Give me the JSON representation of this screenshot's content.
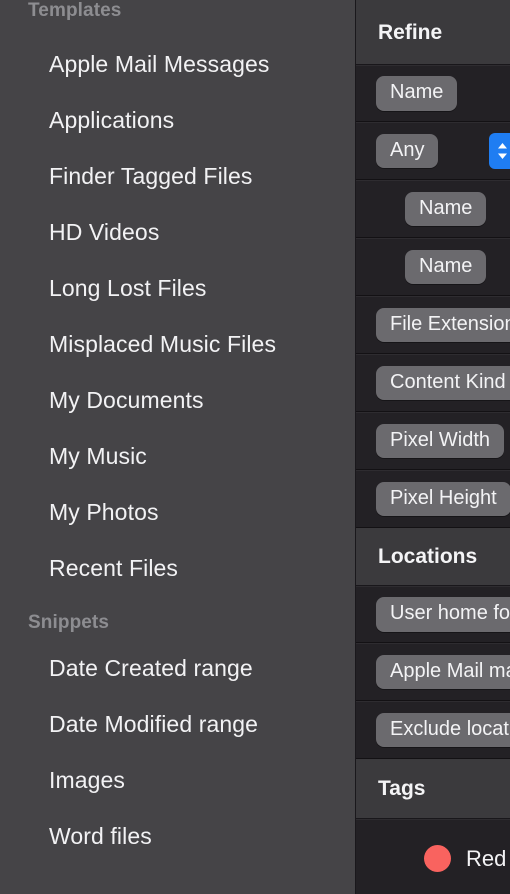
{
  "sidebar": {
    "groups": [
      {
        "title": "Templates",
        "items": [
          {
            "label": "Apple Mail Messages"
          },
          {
            "label": "Applications"
          },
          {
            "label": "Finder Tagged Files"
          },
          {
            "label": "HD Videos"
          },
          {
            "label": "Long Lost Files"
          },
          {
            "label": "Misplaced Music Files"
          },
          {
            "label": "My Documents"
          },
          {
            "label": "My Music"
          },
          {
            "label": "My Photos"
          },
          {
            "label": "Recent Files"
          }
        ]
      },
      {
        "title": "Snippets",
        "items": [
          {
            "label": "Date Created range"
          },
          {
            "label": "Date Modified range"
          },
          {
            "label": "Images"
          },
          {
            "label": "Word files"
          }
        ]
      }
    ]
  },
  "panel": {
    "sections": [
      {
        "header": "Refine",
        "rows": [
          {
            "label": "Name",
            "indent": 0,
            "stepper": false
          },
          {
            "label": "Any",
            "indent": 0,
            "stepper": true
          },
          {
            "label": "Name",
            "indent": 1,
            "stepper": false
          },
          {
            "label": "Name",
            "indent": 1,
            "stepper": false
          },
          {
            "label": "File Extension",
            "indent": 0,
            "stepper": false
          },
          {
            "label": "Content Kind",
            "indent": 0,
            "stepper": false
          },
          {
            "label": "Pixel Width",
            "indent": 0,
            "stepper": false
          },
          {
            "label": "Pixel Height",
            "indent": 0,
            "stepper": false
          }
        ]
      },
      {
        "header": "Locations",
        "rows": [
          {
            "label": "User home folder",
            "indent": 0,
            "stepper": false
          },
          {
            "label": "Apple Mail mailboxes",
            "indent": 0,
            "stepper": false
          },
          {
            "label": "Exclude location",
            "indent": 0,
            "stepper": false
          }
        ]
      },
      {
        "header": "Tags",
        "tags": [
          {
            "label": "Red",
            "color": "#f9635f"
          }
        ]
      }
    ]
  },
  "colors": {
    "sidebar_bg": "#454447",
    "panel_bg": "#232125",
    "section_header_bg": "#3b3a3d",
    "pill_bg": "#6b6a6e",
    "stepper_accent": "#1f7df2",
    "group_header_text": "#8d8d91",
    "primary_text": "#f2f2f4"
  },
  "icons": {
    "stepper": "chevron-up-down-icon",
    "tag_dot": "tag-color-dot-icon"
  }
}
